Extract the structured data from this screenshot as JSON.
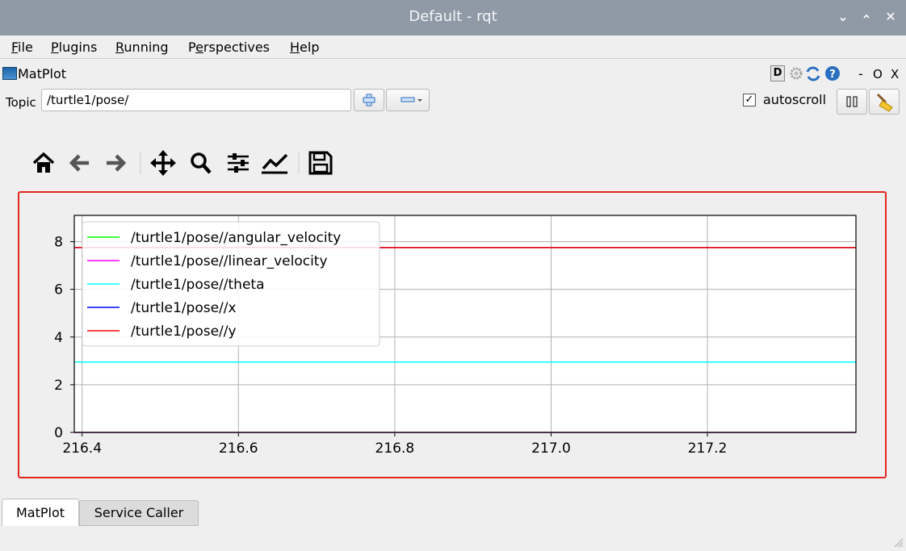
{
  "window": {
    "title": "Default - rqt"
  },
  "menubar": {
    "items": [
      {
        "label": "File",
        "mnemonic": "F",
        "rest": "ile"
      },
      {
        "label": "Plugins",
        "mnemonic": "P",
        "rest": "lugins"
      },
      {
        "label": "Running",
        "mnemonic": "R",
        "rest": "unning"
      },
      {
        "label": "Perspectives",
        "pre": "P",
        "mnemonic": "e",
        "rest": "rspectives"
      },
      {
        "label": "Help",
        "mnemonic": "H",
        "rest": "elp"
      }
    ]
  },
  "plugin": {
    "title": "MatPlot",
    "d_badge": "D",
    "controls": {
      "minimize": "-",
      "restore": "O",
      "close": "X"
    }
  },
  "topic": {
    "label": "Topic",
    "value": "/turtle1/pose/",
    "autoscroll_label": "autoscroll",
    "autoscroll_checked": true
  },
  "tabs": [
    {
      "label": "MatPlot",
      "active": true
    },
    {
      "label": "Service Caller",
      "active": false
    }
  ],
  "chart_data": {
    "type": "line",
    "title": "",
    "xlabel": "",
    "ylabel": "",
    "xlim": [
      216.39,
      217.39
    ],
    "ylim": [
      0,
      9.1
    ],
    "x_ticks": [
      "216.4",
      "216.6",
      "216.8",
      "217.0",
      "217.2"
    ],
    "y_ticks": [
      "0",
      "2",
      "4",
      "6",
      "8"
    ],
    "grid": true,
    "legend_position": "top-left",
    "series": [
      {
        "name": "/turtle1/pose//angular_velocity",
        "color": "#00ff00",
        "x": [
          216.39,
          217.39
        ],
        "y": [
          0,
          0
        ]
      },
      {
        "name": "/turtle1/pose//linear_velocity",
        "color": "#ff00ff",
        "x": [
          216.39,
          217.39
        ],
        "y": [
          0,
          0
        ]
      },
      {
        "name": "/turtle1/pose//theta",
        "color": "#00ffff",
        "x": [
          216.39,
          217.39
        ],
        "y": [
          2.95,
          2.95
        ]
      },
      {
        "name": "/turtle1/pose//x",
        "color": "#0000ff",
        "x": [
          216.39,
          217.39
        ],
        "y": [
          7.75,
          7.75
        ]
      },
      {
        "name": "/turtle1/pose//y",
        "color": "#ff0000",
        "x": [
          216.39,
          217.39
        ],
        "y": [
          7.75,
          7.75
        ]
      }
    ]
  }
}
